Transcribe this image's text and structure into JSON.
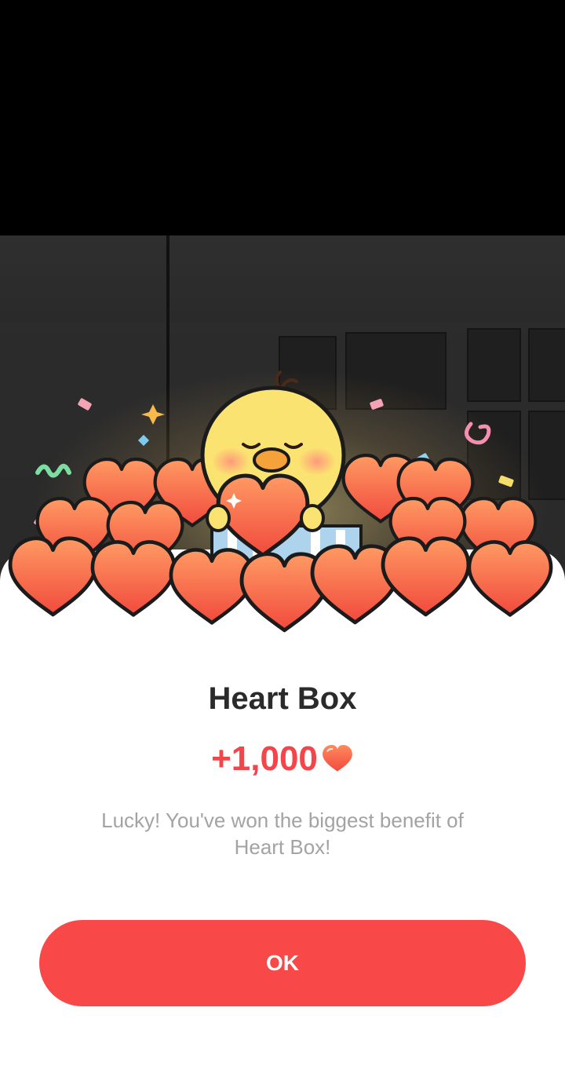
{
  "dialog": {
    "title": "Heart Box",
    "amount": "+1,000",
    "description": "Lucky! You've won the biggest benefit of Heart Box!",
    "ok_label": "OK"
  },
  "icons": {
    "amount_icon": "heart-icon",
    "illustration": "chick-holding-heart-icon"
  },
  "colors": {
    "accent": "#f84848",
    "amount": "#f4464a",
    "title": "#2b2b2b",
    "description": "#a3a3a3",
    "heart_fill_top": "#ff8a5c",
    "heart_fill_bottom": "#f24a3f"
  }
}
